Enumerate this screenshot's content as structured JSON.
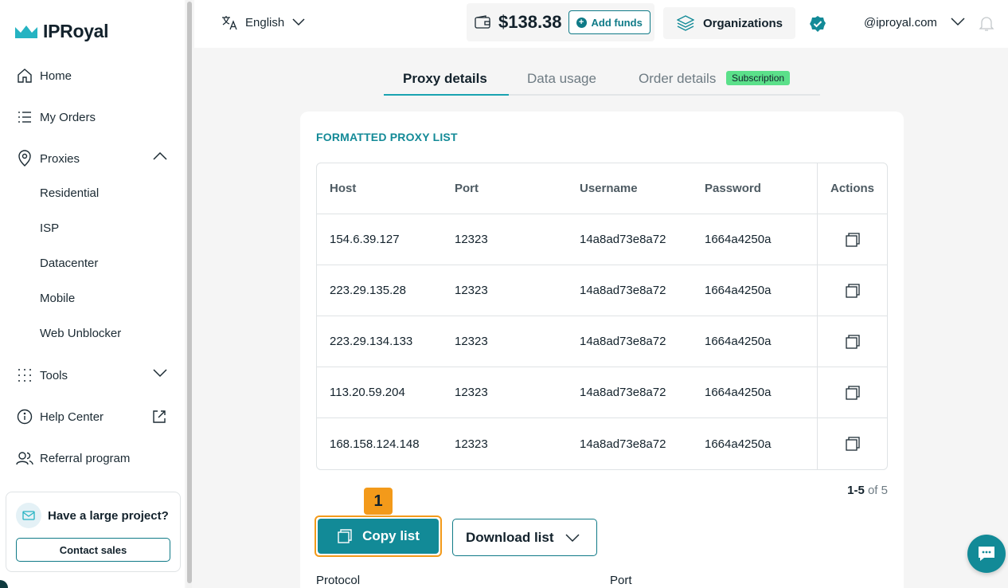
{
  "brand": {
    "name": "IPRoyal",
    "accent": "#128a97",
    "highlight": "#f39a1a"
  },
  "sidebar": {
    "items": [
      {
        "label": "Home",
        "icon": "home-icon"
      },
      {
        "label": "My Orders",
        "icon": "list-icon"
      },
      {
        "label": "Proxies",
        "icon": "location-pin-icon",
        "expanded": true
      },
      {
        "label": "Tools",
        "icon": "grid-dots-icon",
        "expanded": false
      },
      {
        "label": "Help Center",
        "icon": "info-icon"
      },
      {
        "label": "Referral program",
        "icon": "users-icon"
      }
    ],
    "proxies_sub": [
      "Residential",
      "ISP",
      "Datacenter",
      "Mobile",
      "Web Unblocker"
    ],
    "promo": {
      "title": "Have a large project?",
      "button": "Contact sales"
    }
  },
  "topbar": {
    "language": "English",
    "balance": "$138.38",
    "add_funds": "Add funds",
    "organizations": "Organizations",
    "email": "@iproyal.com"
  },
  "tabs": {
    "items": [
      "Proxy details",
      "Data usage",
      "Order details"
    ],
    "active": "Proxy details",
    "badge": "Subscription"
  },
  "card": {
    "title": "FORMATTED PROXY LIST",
    "columns": [
      "Host",
      "Port",
      "Username",
      "Password",
      "Actions"
    ],
    "rows": [
      [
        "154.6.39.127",
        "12323",
        "14a8ad73e8a72",
        "1664a4250a"
      ],
      [
        "223.29.135.28",
        "12323",
        "14a8ad73e8a72",
        "1664a4250a"
      ],
      [
        "223.29.134.133",
        "12323",
        "14a8ad73e8a72",
        "1664a4250a"
      ],
      [
        "113.20.59.204",
        "12323",
        "14a8ad73e8a72",
        "1664a4250a"
      ],
      [
        "168.158.124.148",
        "12323",
        "14a8ad73e8a72",
        "1664a4250a"
      ]
    ],
    "pager": {
      "range": "1-5",
      "of": "of 5"
    },
    "marker": "1",
    "copy_list": "Copy list",
    "download_list": "Download list",
    "protocol_label": "Protocol",
    "port_label": "Port"
  }
}
